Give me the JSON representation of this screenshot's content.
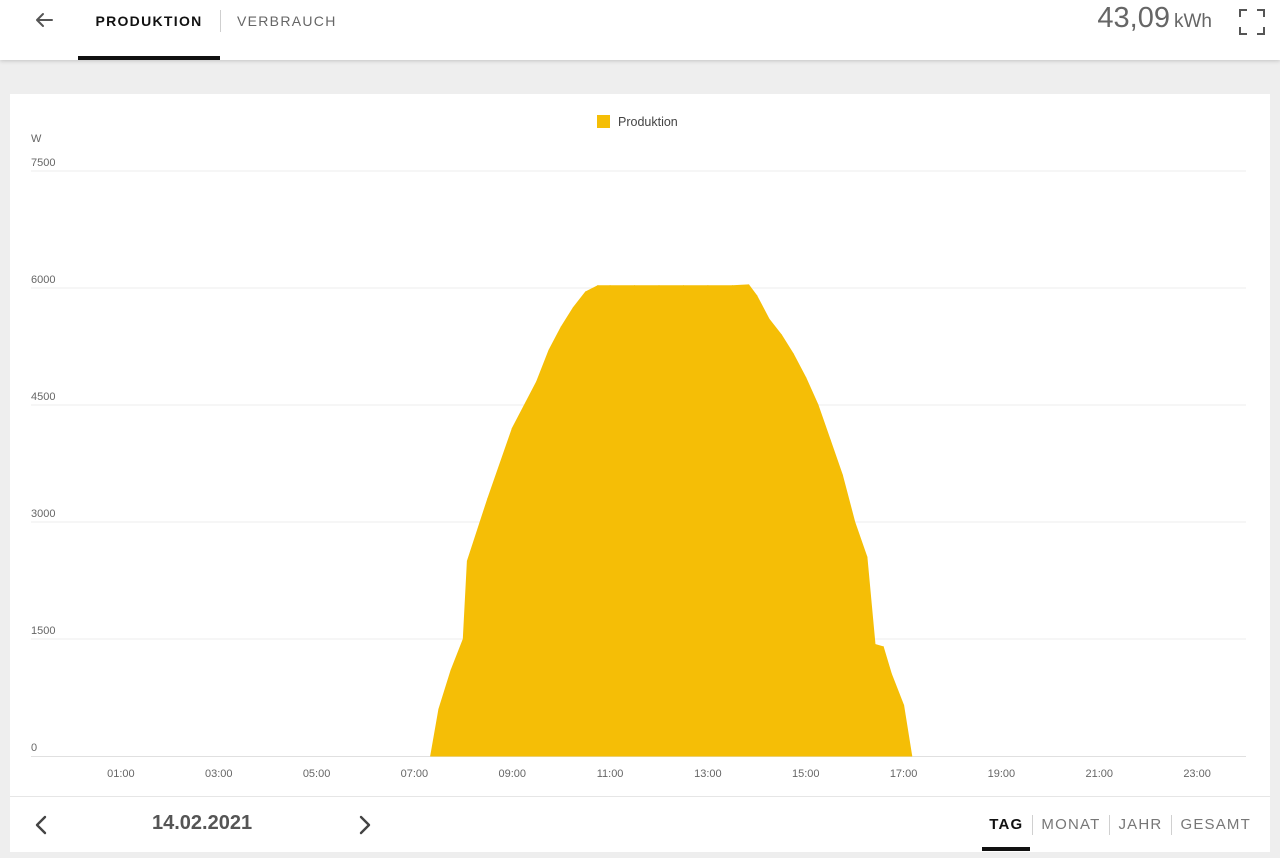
{
  "header": {
    "tabs": [
      {
        "label": "PRODUKTION",
        "active": true
      },
      {
        "label": "VERBRAUCH",
        "active": false
      }
    ],
    "energy_value": "43,09",
    "energy_unit": "kWh"
  },
  "footer": {
    "date": "14.02.2021",
    "period_tabs": [
      {
        "label": "TAG",
        "active": true
      },
      {
        "label": "MONAT",
        "active": false
      },
      {
        "label": "JAHR",
        "active": false
      },
      {
        "label": "GESAMT",
        "active": false
      }
    ]
  },
  "colors": {
    "production": "#F5BE06",
    "grid": "#ececec",
    "tick_text": "#666666"
  },
  "icons": {
    "back": "arrow-left-icon",
    "fullscreen": "fullscreen-icon",
    "prev": "chevron-left-icon",
    "next": "chevron-right-icon"
  },
  "chart_data": {
    "type": "area",
    "legend": [
      "Produktion"
    ],
    "legend_position": "top-center",
    "ylabel": "W",
    "ylim": [
      0,
      7500
    ],
    "yticks": [
      0,
      1500,
      3000,
      4500,
      6000,
      7500
    ],
    "xlim": [
      0,
      24
    ],
    "xticks": [
      "01:00",
      "03:00",
      "05:00",
      "07:00",
      "09:00",
      "11:00",
      "13:00",
      "15:00",
      "17:00",
      "19:00",
      "21:00",
      "23:00"
    ],
    "grid": true,
    "series": [
      {
        "name": "Produktion",
        "color": "#F5BE06",
        "points": [
          [
            "07:20",
            0
          ],
          [
            "07:30",
            600
          ],
          [
            "07:45",
            1100
          ],
          [
            "08:00",
            1500
          ],
          [
            "08:05",
            2500
          ],
          [
            "08:30",
            3300
          ],
          [
            "09:00",
            4200
          ],
          [
            "09:30",
            4800
          ],
          [
            "09:45",
            5200
          ],
          [
            "10:00",
            5500
          ],
          [
            "10:15",
            5750
          ],
          [
            "10:30",
            5950
          ],
          [
            "10:45",
            6030
          ],
          [
            "11:00",
            6030
          ],
          [
            "11:30",
            6030
          ],
          [
            "12:00",
            6030
          ],
          [
            "12:30",
            6030
          ],
          [
            "13:00",
            6030
          ],
          [
            "13:30",
            6030
          ],
          [
            "13:50",
            6040
          ],
          [
            "14:00",
            5900
          ],
          [
            "14:15",
            5600
          ],
          [
            "14:30",
            5400
          ],
          [
            "14:45",
            5150
          ],
          [
            "15:00",
            4850
          ],
          [
            "15:15",
            4500
          ],
          [
            "15:30",
            4050
          ],
          [
            "15:45",
            3600
          ],
          [
            "16:00",
            3000
          ],
          [
            "16:15",
            2550
          ],
          [
            "16:25",
            1430
          ],
          [
            "16:35",
            1400
          ],
          [
            "16:45",
            1050
          ],
          [
            "17:00",
            650
          ],
          [
            "17:10",
            0
          ]
        ]
      }
    ]
  }
}
